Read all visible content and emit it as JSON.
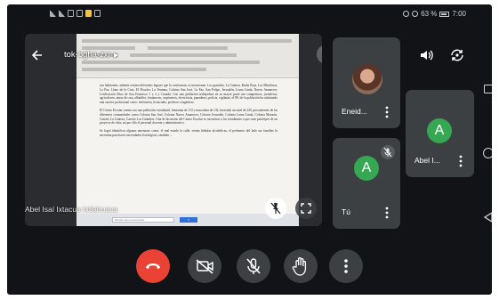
{
  "status_bar": {
    "battery_text": "63 %",
    "time": "7:00"
  },
  "main_tile": {
    "meeting_code": "tok-bgha-zxr",
    "presenter_name": "Abel Isaí Ixtacua Ixtlahuaca",
    "document": {
      "paragraphs": [
        "son habitantes, además existen diferentes lugares que lo conforman, se mencionan: Los grandios, La Cantera, Barba Roja, Los Mendozas, La Paz, Llano de la Cruz, El Picacho, La Ventana, Colonia San José, La Paz, San Felipe, Jerusalén, Loma Linda, Nuevo Amanecer, Lotificación Altos de San Francisco 1 y 2 y Canadá. Con una población trabajadora en su mayor parte son campesinos, jornaleros, agricultores, amas de casa, albañiles, fontaneros, carpinteros, electricista, panaderos, policía, vigilante; el 8% de la población ha culminado una carrera profesional como: enfermera, licenciado, profesor e ingeniero.",
        "El Centro Escolar cuenta con una población estudiantil, femenina de 113 y masculina de 132, haciendo un total de 245, provenientes de las diferentes comunidades como Colonia San José, Colonia Nuevo Amanecer, Colonia Jerusalén, Colonia Loma Linda, Colonia Monzón, Caserío La Cantera, Caserío Los Grandios. Una de las metas del Centro Escolar es incentivar a los estudiantes a que sean partícipes de un proyecto de vida, así por ello el personal docente y administrativo.",
        "Se logró identificar algunas amenazas como: el mal estado la calle, ventas bebidas alcohólicas, el perímetro del lado sur familias lo necesitan para hacer necesidades fisiológicas, también ..."
      ],
      "search_placeholder": "Escribe aquí para buscar",
      "search_button": "Ir"
    }
  },
  "participants": [
    {
      "name": "Eneid...",
      "avatar_type": "photo",
      "muted": false
    },
    {
      "name": "Abel I...",
      "avatar_letter": "A",
      "muted": false
    },
    {
      "name": "Tú",
      "avatar_letter": "A",
      "muted": true
    }
  ],
  "icons": {
    "back": "arrow-left-icon",
    "speaker": "speaker-icon",
    "switch_camera": "switch-camera-icon",
    "end_call": "phone-hangup-icon",
    "camera_off": "camera-off-icon",
    "mic_off": "mic-off-icon",
    "raise_hand": "hand-icon",
    "more": "more-vert-icon"
  },
  "colors": {
    "end_call": "#ea4335",
    "avatar": "#36a853",
    "active_speaker": "#3b4aa6",
    "control_bg": "#3c4043"
  }
}
